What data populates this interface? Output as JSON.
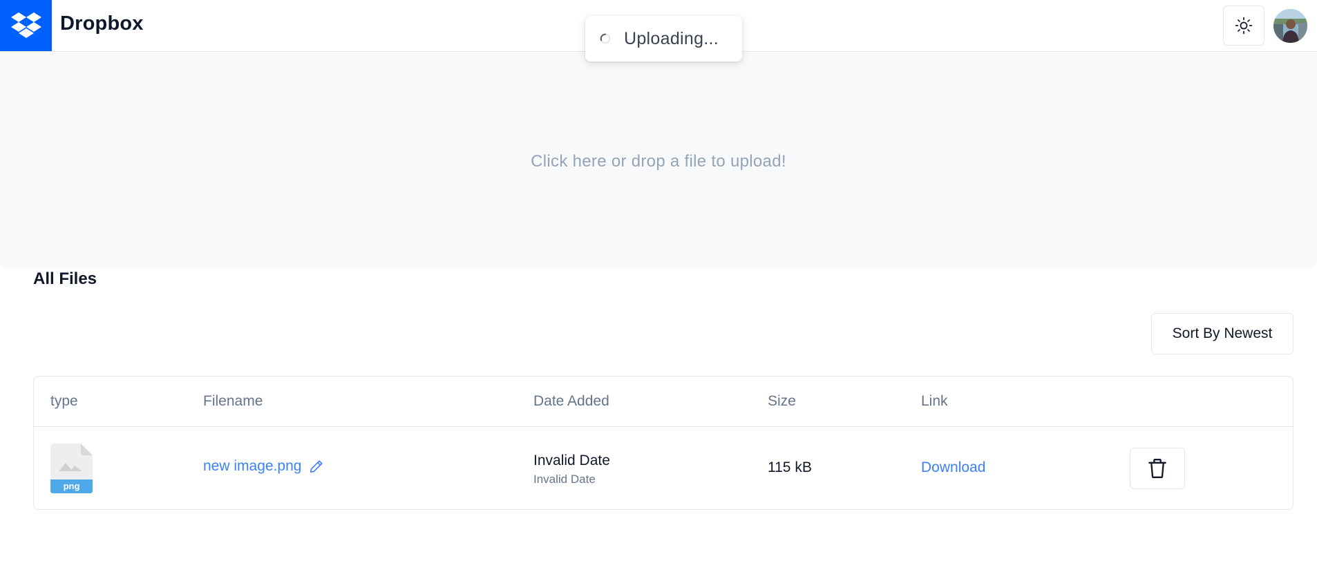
{
  "header": {
    "brand": "Dropbox",
    "icons": {
      "logo": "dropbox-logo-icon",
      "theme": "sun-icon",
      "avatar": "user-avatar"
    }
  },
  "toast": {
    "text": "Uploading...",
    "icon": "spinner-icon"
  },
  "dropzone": {
    "hint": "Click here or drop a file to upload!"
  },
  "files": {
    "title": "All Files",
    "sort_label": "Sort By Newest",
    "columns": [
      "type",
      "Filename",
      "Date Added",
      "Size",
      "Link"
    ],
    "rows": [
      {
        "type_label": "png",
        "filename": "new image.png",
        "date_main": "Invalid Date",
        "date_sub": "Invalid Date",
        "size": "115 kB",
        "link_text": "Download"
      }
    ]
  },
  "colors": {
    "brand": "#0061fe",
    "link": "#3b82f6",
    "file_badge": "#4fa8e8"
  }
}
